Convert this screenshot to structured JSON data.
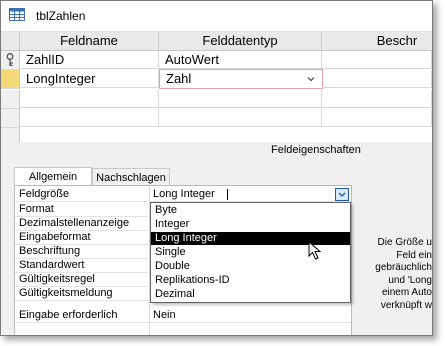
{
  "window": {
    "title": "tblZahlen"
  },
  "design_grid": {
    "headers": [
      "Feldname",
      "Felddatentyp",
      "Beschr"
    ],
    "rows": [
      {
        "name": "ZahlID",
        "type": "AutoWert",
        "key": true
      },
      {
        "name": "LongInteger",
        "type": "Zahl",
        "key": false,
        "active": true
      }
    ]
  },
  "properties": {
    "section_label": "Feldeigenschaften",
    "tabs": [
      "Allgemein",
      "Nachschlagen"
    ],
    "active_tab": "Allgemein",
    "rows": [
      {
        "name": "Feldgröße",
        "value": "Long Integer"
      },
      {
        "name": "Format",
        "value": ""
      },
      {
        "name": "Dezimalstellenanzeige",
        "value": ""
      },
      {
        "name": "Eingabeformat",
        "value": ""
      },
      {
        "name": "Beschriftung",
        "value": ""
      },
      {
        "name": "Standardwert",
        "value": ""
      },
      {
        "name": "Gültigkeitsregel",
        "value": ""
      },
      {
        "name": "Gültigkeitsmeldung",
        "value": ""
      },
      {
        "name": "Eingabe erforderlich",
        "value": "Nein"
      }
    ],
    "dropdown_options": [
      "Byte",
      "Integer",
      "Long Integer",
      "Single",
      "Double",
      "Replikations-ID",
      "Dezimal"
    ],
    "dropdown_selected": "Long Integer",
    "help_text": [
      "Die Größe u",
      "Feld ein",
      "gebräuchlich",
      "und 'Long",
      "einem Auto",
      "verknüpft w"
    ]
  },
  "colors": {
    "selected_bg": "#000000",
    "active_border": "#e8a0a8",
    "dropdown_arrow": "#1e5aa8"
  }
}
